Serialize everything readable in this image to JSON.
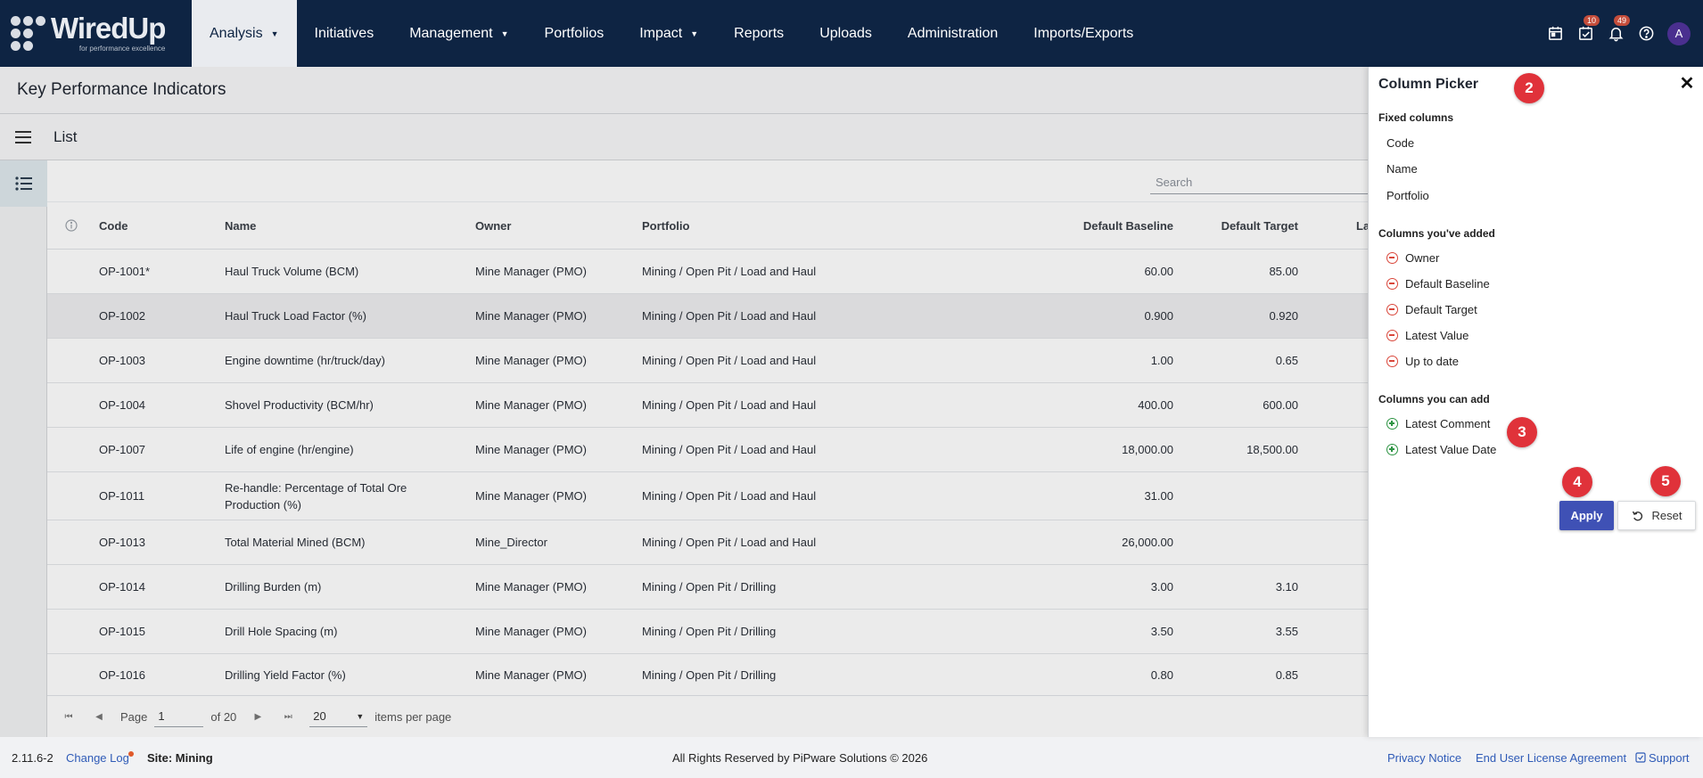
{
  "brand": {
    "name": "WiredUp",
    "tagline": "for performance excellence"
  },
  "nav": {
    "items": [
      {
        "label": "Analysis",
        "caret": "▼",
        "active": true
      },
      {
        "label": "Initiatives",
        "caret": ""
      },
      {
        "label": "Management",
        "caret": "▼"
      },
      {
        "label": "Portfolios",
        "caret": ""
      },
      {
        "label": "Impact",
        "caret": "▼"
      },
      {
        "label": "Reports",
        "caret": ""
      },
      {
        "label": "Uploads",
        "caret": ""
      },
      {
        "label": "Administration",
        "caret": ""
      },
      {
        "label": "Imports/Exports",
        "caret": ""
      }
    ],
    "tasks_badge": "10",
    "notifications_badge": "49",
    "avatar_initial": "A"
  },
  "page": {
    "title": "Key Performance Indicators",
    "view_label": "List"
  },
  "search": {
    "placeholder": "Search"
  },
  "table": {
    "headers": {
      "code": "Code",
      "name": "Name",
      "owner": "Owner",
      "portfolio": "Portfolio",
      "baseline": "Default Baseline",
      "target": "Default Target",
      "latest": "La"
    },
    "rows": [
      {
        "code": "OP-1001*",
        "name": "Haul Truck Volume (BCM)",
        "owner": "Mine Manager (PMO)",
        "portfolio": "Mining / Open Pit / Load and Haul",
        "baseline": "60.00",
        "target": "85.00"
      },
      {
        "code": "OP-1002",
        "name": "Haul Truck Load Factor (%)",
        "owner": "Mine Manager (PMO)",
        "portfolio": "Mining / Open Pit / Load and Haul",
        "baseline": "0.900",
        "target": "0.920"
      },
      {
        "code": "OP-1003",
        "name": "Engine downtime (hr/truck/day)",
        "owner": "Mine Manager (PMO)",
        "portfolio": "Mining / Open Pit / Load and Haul",
        "baseline": "1.00",
        "target": "0.65"
      },
      {
        "code": "OP-1004",
        "name": "Shovel Productivity (BCM/hr)",
        "owner": "Mine Manager (PMO)",
        "portfolio": "Mining / Open Pit / Load and Haul",
        "baseline": "400.00",
        "target": "600.00"
      },
      {
        "code": "OP-1007",
        "name": "Life of engine (hr/engine)",
        "owner": "Mine Manager (PMO)",
        "portfolio": "Mining / Open Pit / Load and Haul",
        "baseline": "18,000.00",
        "target": "18,500.00"
      },
      {
        "code": "OP-1011",
        "name": "Re-handle: Percentage of Total Ore Production (%)",
        "owner": "Mine Manager (PMO)",
        "portfolio": "Mining / Open Pit / Load and Haul",
        "baseline": "31.00",
        "target": ""
      },
      {
        "code": "OP-1013",
        "name": "Total Material Mined (BCM)",
        "owner": "Mine_Director",
        "portfolio": "Mining / Open Pit / Load and Haul",
        "baseline": "26,000.00",
        "target": ""
      },
      {
        "code": "OP-1014",
        "name": "Drilling Burden (m)",
        "owner": "Mine Manager (PMO)",
        "portfolio": "Mining / Open Pit / Drilling",
        "baseline": "3.00",
        "target": "3.10"
      },
      {
        "code": "OP-1015",
        "name": "Drill Hole Spacing (m)",
        "owner": "Mine Manager (PMO)",
        "portfolio": "Mining / Open Pit / Drilling",
        "baseline": "3.50",
        "target": "3.55"
      },
      {
        "code": "OP-1016",
        "name": "Drilling Yield Factor (%)",
        "owner": "Mine Manager (PMO)",
        "portfolio": "Mining / Open Pit / Drilling",
        "baseline": "0.80",
        "target": "0.85"
      }
    ]
  },
  "pager": {
    "page_label": "Page",
    "page_value": "1",
    "of_label": "of 20",
    "per_page": "20",
    "per_page_label": "items per page"
  },
  "footer": {
    "version": "2.11.6-2",
    "changelog": "Change Log",
    "site": "Site: Mining",
    "rights": "All Rights Reserved by PiPware Solutions © 2026",
    "privacy": "Privacy Notice",
    "eula": "End User License Agreement",
    "support": "Support"
  },
  "picker": {
    "title": "Column Picker",
    "fixed_title": "Fixed columns",
    "fixed": [
      "Code",
      "Name",
      "Portfolio"
    ],
    "added_title": "Columns you've added",
    "added": [
      "Owner",
      "Default Baseline",
      "Default Target",
      "Latest Value",
      "Up to date"
    ],
    "available_title": "Columns you can add",
    "available": [
      "Latest Comment",
      "Latest Value Date"
    ],
    "apply_label": "Apply",
    "reset_label": "Reset"
  },
  "markers": [
    "2",
    "3",
    "4",
    "5"
  ],
  "colors": {
    "nav_bg": "#0e2443",
    "primary": "#3f51b5",
    "remove": "#d9473b",
    "add": "#2e9444",
    "marker": "#e0323a"
  }
}
